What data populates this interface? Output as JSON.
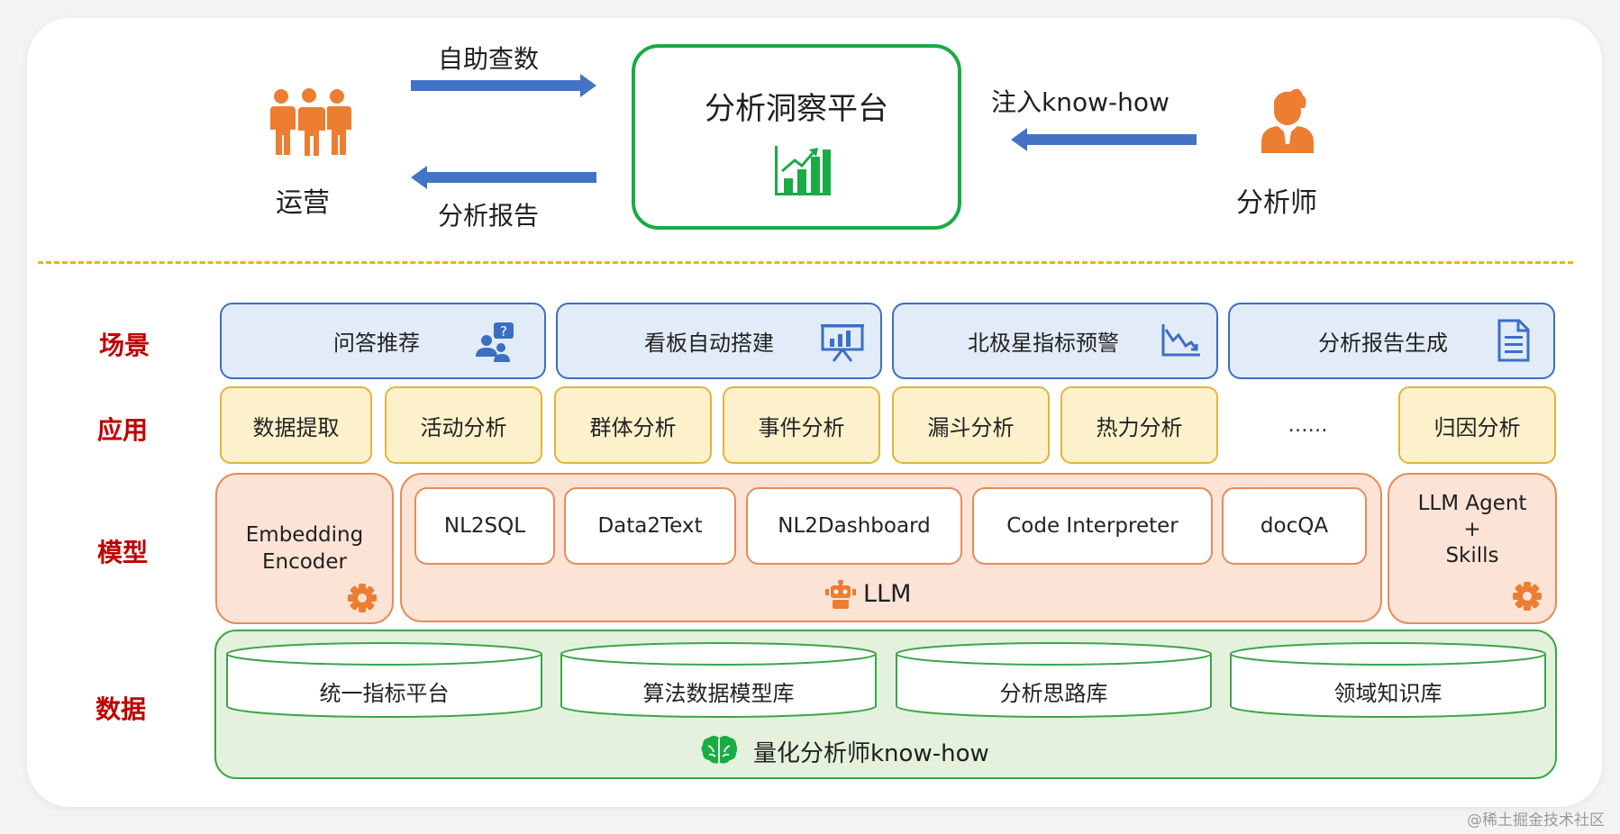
{
  "top": {
    "platform_title": "分析洞察平台",
    "ops_label": "运营",
    "analyst_label": "分析师",
    "arrow_self_query": "自助查数",
    "arrow_report": "分析报告",
    "arrow_knowhow": "注入know-how"
  },
  "layers": {
    "scene": "场景",
    "app": "应用",
    "model": "模型",
    "data": "数据"
  },
  "scenes": [
    {
      "label": "问答推荐",
      "icon": "qa-user-icon"
    },
    {
      "label": "看板自动搭建",
      "icon": "presentation-board-icon"
    },
    {
      "label": "北极星指标预警",
      "icon": "trend-down-chart-icon"
    },
    {
      "label": "分析报告生成",
      "icon": "document-icon"
    }
  ],
  "apps": [
    "数据提取",
    "活动分析",
    "群体分析",
    "事件分析",
    "漏斗分析",
    "热力分析",
    "……",
    "归因分析"
  ],
  "models": {
    "embedding": "Embedding\nEncoder",
    "llm_modules": [
      "NL2SQL",
      "Data2Text",
      "NL2Dashboard",
      "Code Interpreter",
      "docQA"
    ],
    "llm_label": "LLM",
    "agent": "LLM Agent\n+\nSkills"
  },
  "data": {
    "stores": [
      "统一指标平台",
      "算法数据模型库",
      "分析思路库",
      "领域知识库"
    ],
    "footer": "量化分析师know-how"
  },
  "watermark": "@稀土掘金技术社区",
  "colors": {
    "blue_arrow": "#4472c4",
    "green_border": "#1aab44",
    "orange_person": "#ed7d31",
    "layer_label": "#c00000",
    "divider": "#f0b400"
  }
}
